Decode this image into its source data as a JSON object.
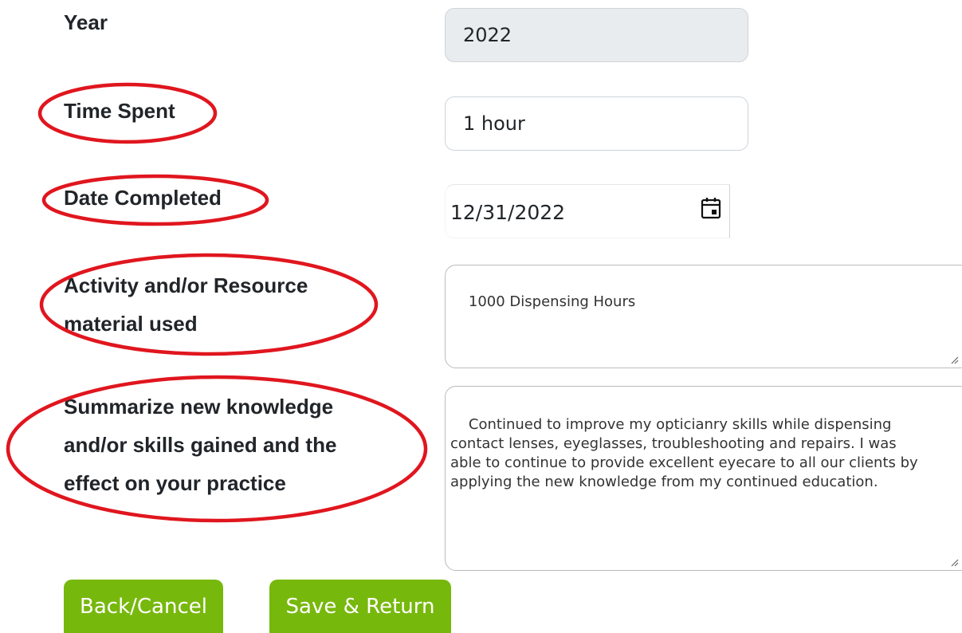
{
  "form": {
    "year_label": "Year",
    "year_value": "2022",
    "time_spent_label": "Time Spent",
    "time_spent_value": "1 hour",
    "date_completed_label": "Date Completed",
    "date_completed_value": "12/31/2022",
    "activity_label_line1": "Activity and/or Resource",
    "activity_label_line2": "material used",
    "activity_value": "1000 Dispensing Hours",
    "summary_label_line1": "Summarize new knowledge",
    "summary_label_line2": "and/or skills gained and the",
    "summary_label_line3": "effect on your practice",
    "summary_value": "Continued to improve my opticianry skills while dispensing\ncontact lenses, eyeglasses, troubleshooting and repairs. I was\nable to continue to provide excellent eyecare to all our clients by\napplying the new knowledge from my continued education."
  },
  "buttons": {
    "back_cancel": "Back/Cancel",
    "save_return": "Save & Return"
  },
  "icons": {
    "date_picker": "calendar-icon",
    "resize_handle": "resize-grip-icon"
  },
  "colors": {
    "button_green": "#77b80d",
    "annotation_red": "#e0161e",
    "readonly_bg": "#e9ecef"
  }
}
